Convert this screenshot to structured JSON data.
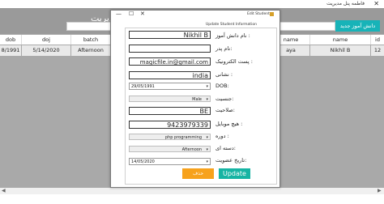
{
  "main": {
    "title": "فاطمه پنل مدیریت",
    "header_title": "مدیریت",
    "add_button": "دانش آموز جدید",
    "columns": [
      "dob",
      "doj",
      "batch",
      "name",
      "name",
      "id"
    ],
    "row": [
      "8/1991",
      "5/14/2020",
      "Afternoon",
      "aya",
      "Nikhil B",
      "12"
    ]
  },
  "dialog": {
    "title": "Edit Student",
    "group_label": "Update Student Information",
    "fields": {
      "name": {
        "label": "نام دانش آموز :",
        "value": "Nikhil B"
      },
      "father": {
        "label": "نام پدر:",
        "value": ""
      },
      "email": {
        "label": "پست الکترونیک :",
        "value": "magicfile.in@gmail.com"
      },
      "address": {
        "label": "نشانی :",
        "value": "india"
      },
      "dob": {
        "label": "DOB:",
        "value": "29/05/1991"
      },
      "gender": {
        "label": "جنسیت:",
        "value": "Male"
      },
      "qualification": {
        "label": "صلاحیت:",
        "value": "BE"
      },
      "mobile": {
        "label": "هیچ موبایل :",
        "value": "9423979339"
      },
      "course": {
        "label": "دوره :",
        "value": "php programming"
      },
      "batch": {
        "label": "دسته ای:",
        "value": "Afternoon"
      },
      "doj": {
        "label": "تاریخ عضویت:",
        "value": "14/05/2020"
      }
    },
    "cancel_label": "حذف",
    "update_label": "Update"
  }
}
